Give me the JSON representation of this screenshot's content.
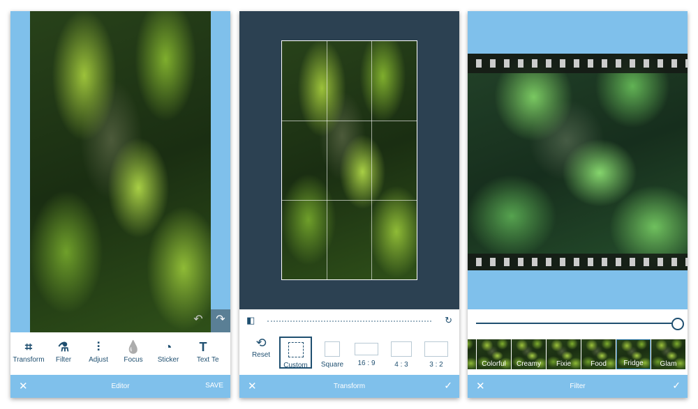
{
  "editor": {
    "title": "Editor",
    "save": "SAVE",
    "close": "✕",
    "tools": [
      {
        "label": "Transform",
        "icon": "⌗"
      },
      {
        "label": "Filter",
        "icon": "⚗"
      },
      {
        "label": "Adjust",
        "icon": "⫶"
      },
      {
        "label": "Focus",
        "icon": "💧"
      },
      {
        "label": "Sticker",
        "icon": "◔"
      },
      {
        "label": "Text",
        "icon": "T"
      },
      {
        "label": "Te"
      }
    ]
  },
  "transform": {
    "title": "Transform",
    "close": "✕",
    "confirm": "✓",
    "ratios": [
      {
        "label": "Reset"
      },
      {
        "label": "Custom",
        "selected": true
      },
      {
        "label": "Square"
      },
      {
        "label": "16 : 9"
      },
      {
        "label": "4 : 3"
      },
      {
        "label": "3 : 2"
      }
    ]
  },
  "filter": {
    "title": "Filter",
    "close": "✕",
    "confirm": "✓",
    "intensity": 1.0,
    "filters": [
      "c",
      "Colorful",
      "Creamy",
      "Fixie",
      "Food",
      "Fridge",
      "Glam"
    ],
    "selected": "Fridge"
  },
  "colors": {
    "accent": "#7fc0eb",
    "dark": "#2c4152",
    "icon": "#1f4f70"
  }
}
